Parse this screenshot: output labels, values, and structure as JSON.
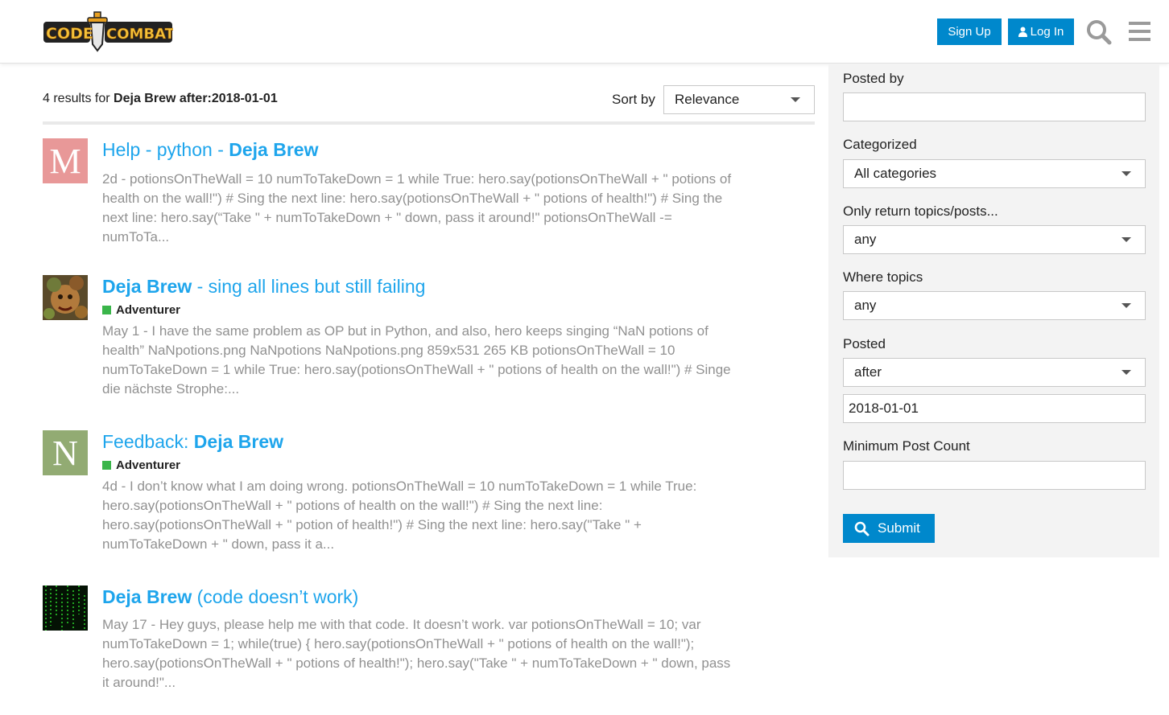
{
  "header": {
    "logo_text": "CODECOMBAT",
    "signup_label": "Sign Up",
    "login_label": "Log In",
    "accent_color": "#0088cc",
    "icons": [
      "user-icon",
      "search-icon",
      "menu-icon"
    ]
  },
  "results": {
    "count_prefix": "4 results for",
    "query": "Deja Brew after:2018-01-01",
    "sort_label": "Sort by",
    "sort_value": "Relevance",
    "items": [
      {
        "avatar_letter": "M",
        "avatar_color": "#e89898",
        "title_prefix": "Help - python - ",
        "title_highlight": "Deja Brew",
        "title_suffix": "",
        "category": "",
        "blurb": "2d - potionsOnTheWall = 10 numToTakeDown = 1 while True: hero.say(potionsOnTheWall + \" potions of health on the wall!\") # Sing the next line: hero.say(potionsOnTheWall + \" potions of health!\") # Sing the next line: hero.say(“Take \" + numToTakeDown + \" down, pass it around!\" potionsOnTheWall -= numToTa..."
      },
      {
        "avatar_letter": "",
        "avatar_color": "#6b5a3a",
        "title_prefix": "",
        "title_highlight": "Deja Brew",
        "title_suffix": " - sing all lines but still failing",
        "category": "Adventurer",
        "blurb": "May 1 - I have the same problem as OP but in Python, and also, hero keeps singing “NaN potions of health” NaNpotions.png NaNpotions NaNpotions.png 859x531 265 KB potionsOnTheWall = 10 numToTakeDown = 1 while True: hero.say(potionsOnTheWall + \" potions of health on the wall!\") # Singe die nächste Strophe:..."
      },
      {
        "avatar_letter": "N",
        "avatar_color": "#92ab73",
        "title_prefix": "Feedback: ",
        "title_highlight": "Deja Brew",
        "title_suffix": "",
        "category": "Adventurer",
        "blurb": "4d - I don’t know what I am doing wrong. potionsOnTheWall = 10 numToTakeDown = 1 while True: hero.say(potionsOnTheWall + \" potions of health on the wall!\") # Sing the next line: hero.say(potionsOnTheWall + \" potion of health!\") # Sing the next line: hero.say(\"Take \" + numToTakeDown + \" down, pass it a..."
      },
      {
        "avatar_letter": "",
        "avatar_color": "#0a2a0a",
        "title_prefix": "",
        "title_highlight": "Deja Brew",
        "title_suffix": " (code doesn’t work)",
        "category": "",
        "blurb": "May 17 - Hey guys, please help me with that code. It doesn’t work. var potionsOnTheWall = 10; var numToTakeDown = 1; while(true) { hero.say(potionsOnTheWall + \" potions of health on the wall!\"); hero.say(potionsOnTheWall + \" potions of health!\"); hero.say(\"Take \" + numToTakeDown + \" down, pass it around!\"..."
      }
    ]
  },
  "sidebar": {
    "posted_by_label": "Posted by",
    "posted_by_value": "",
    "categorized_label": "Categorized",
    "categorized_value": "All categories",
    "only_return_label": "Only return topics/posts...",
    "only_return_value": "any",
    "where_topics_label": "Where topics",
    "where_topics_value": "any",
    "posted_label": "Posted",
    "posted_value": "after",
    "posted_date": "2018-01-01",
    "min_post_count_label": "Minimum Post Count",
    "min_post_count_value": "",
    "submit_label": "Submit"
  },
  "colors": {
    "link": "#1ea5ec",
    "muted_text": "#919191",
    "category_green": "#3ab54a",
    "sidebar_bg": "#f3f3f3"
  }
}
